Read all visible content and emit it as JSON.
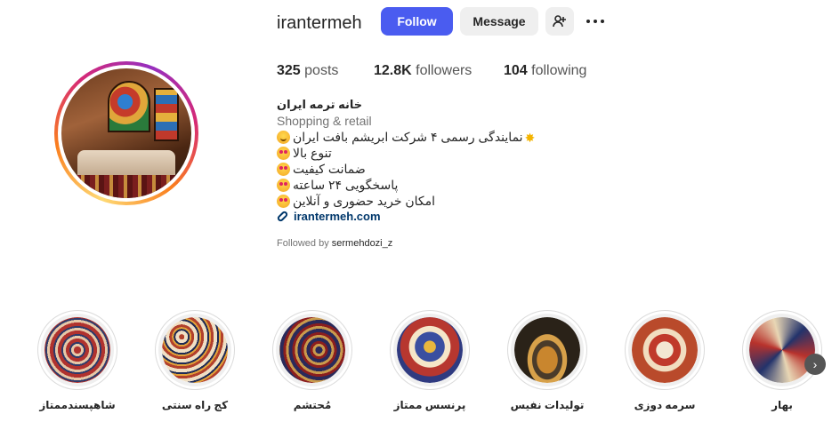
{
  "profile": {
    "username": "irantermeh",
    "follow_label": "Follow",
    "message_label": "Message",
    "add_user_icon": "add-user-icon",
    "more_icon": "more-options-icon",
    "stats": {
      "posts_count": "325",
      "posts_label": "posts",
      "followers_count": "12.8K",
      "followers_label": "followers",
      "following_count": "104",
      "following_label": "following"
    },
    "bio": {
      "name": "خانه ترمه ایران",
      "category": "Shopping & retail",
      "lines": [
        "نمایندگی رسمی ۴ شرکت ابریشم بافت ایران",
        "تنوع بالا",
        "ضمانت کیفیت",
        "پاسخگویی ۲۴ ساعته",
        "امکان خرید حضوری و آنلاین"
      ],
      "link": "irantermeh.com",
      "followed_by_prefix": "Followed by",
      "followed_by_user": "sermehdozi_z"
    }
  },
  "highlights": [
    {
      "label": "شاهپسندممتاز"
    },
    {
      "label": "کج راه سنتی"
    },
    {
      "label": "مُحتشم"
    },
    {
      "label": "پرنسس ممتاز"
    },
    {
      "label": "تولیدات نفیس"
    },
    {
      "label": "سرمه دوزی"
    },
    {
      "label": "بهار"
    }
  ],
  "next_icon": "chevron-right-icon",
  "colors": {
    "follow_button": "#4a5cf0",
    "secondary_button": "#efefef",
    "link": "#00376b"
  }
}
